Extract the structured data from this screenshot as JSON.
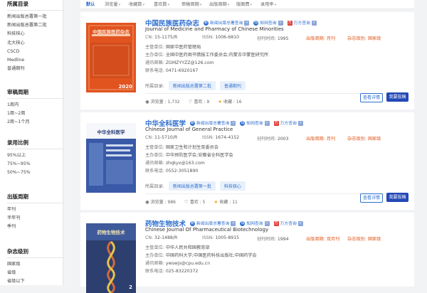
{
  "sidebar": {
    "sections": [
      {
        "title": "所属目录",
        "items": [
          "新闻出版总署第一批",
          "新闻出版总署第二批",
          "科技核心",
          "北大核心",
          "CSCD",
          "Medline",
          "普通期刊"
        ]
      },
      {
        "title": "审稿周期",
        "items": [
          "1周内",
          "1周~2周",
          "2周~1个月"
        ]
      },
      {
        "title": "录用比例",
        "items": [
          "95%以上",
          "75%~95%",
          "50%~75%"
        ]
      },
      {
        "title": "出版周期",
        "items": [
          "年刊",
          "半年刊",
          "季刊"
        ]
      },
      {
        "title": "杂志级别",
        "items": [
          "国家级",
          "省级",
          "省级以下"
        ]
      }
    ]
  },
  "sortbar": {
    "items": [
      {
        "label": "默认",
        "active": true
      },
      {
        "label": "浏览量",
        "active": false
      },
      {
        "label": "收藏数",
        "active": false
      },
      {
        "label": "喜欢数",
        "active": false
      },
      {
        "label": "审稿周期",
        "active": false
      },
      {
        "label": "出版周期",
        "active": false
      },
      {
        "label": "版面费",
        "active": false
      },
      {
        "label": "录用率",
        "active": false
      }
    ]
  },
  "labels": {
    "cn": "CN:",
    "issn": "ISSN:",
    "founded": "创刊时间:",
    "freq": "出版周期:",
    "level": "杂志级别:",
    "sponsor": "主管单位:",
    "organizer": "主办单位:",
    "email": "通讯邮箱:",
    "phone": "联系电话:",
    "category": "所属目录:",
    "views": "浏览量",
    "likes": "喜欢",
    "favorites": "收藏",
    "view_btn": "查看详情",
    "submit_btn": "我要投稿",
    "tag_xw": "新闻出版总署查询",
    "tag_zw": "知网查询",
    "tag_wf": "万方查询"
  },
  "journals": [
    {
      "cn_title": "中国民族医药杂志",
      "en_title": "Journal of Medicine and Pharmacy of Chinese Minorities",
      "cn": "15-1175/R",
      "issn": "1006-6810",
      "founded": "1995",
      "freq": "月刊",
      "level": "国家级",
      "sponsor": "国家中医药管理局",
      "organizer": "全国中医药图书情报工作委员会;内蒙古中蒙医研究所",
      "email": "ZGMZYYZZ@126.com",
      "phone": "0471-6920167",
      "categories": [
        "新闻出版总署第二批",
        "普通期刊"
      ],
      "views": "1,732",
      "likes": "9",
      "favorites": "16",
      "cover_title": "中国民族医药杂志",
      "cover_year": "2020",
      "cover_color": "#e1541f"
    },
    {
      "cn_title": "中华全科医学",
      "en_title": "Chinese Journal of General Practice",
      "cn": "11-5710/R",
      "issn": "1674-4152",
      "founded": "2003",
      "freq": "月刊",
      "level": "国家级",
      "sponsor": "国家卫生和计划生育委员会",
      "organizer": "中华预防医学会;安徽省全科医学会",
      "email": "zhqkyx@163.com",
      "phone": "0552-3051890",
      "categories": [
        "新闻出版总署第一批",
        "科技核心"
      ],
      "views": "986",
      "likes": "5",
      "favorites": "11",
      "cover_title": "中华全科医学",
      "cover_year": "",
      "cover_color": "#3a5aa8"
    },
    {
      "cn_title": "药物生物技术",
      "en_title": "Chinese Journal Of Pharmaceutical Biotechnology",
      "cn": "32-1488/R",
      "issn": "1005-8915",
      "founded": "1994",
      "freq": "双月刊",
      "level": "国家级",
      "sponsor": "中华人民共和国教育部",
      "organizer": "中国药科大学;中国医药科技出版社;中国药学会",
      "email": "ywswjs@cpu.edu.cn",
      "phone": "025-83220372",
      "categories": [],
      "views": "",
      "likes": "",
      "favorites": "",
      "cover_title": "药物生物技术",
      "cover_year": "2",
      "cover_color": "#2d3f6e"
    }
  ],
  "colors": {
    "accent": "#2f6fcf",
    "button": "#2348b8",
    "freq": "#e05a1e"
  }
}
